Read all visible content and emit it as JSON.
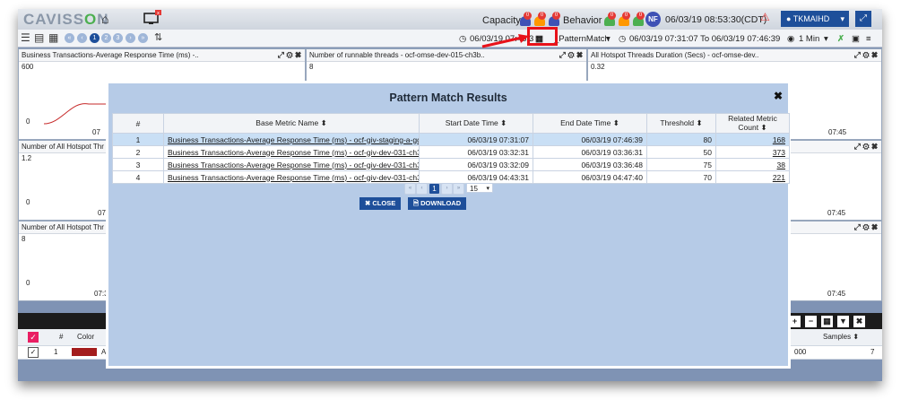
{
  "app": {
    "logo_text_before": "CAVISS",
    "logo_text_o": "O",
    "logo_text_after": "N",
    "capacity_label": "Capacity",
    "behavior_label": "Behavior",
    "alert_counts": [
      "0",
      "0",
      "0",
      "0",
      "0",
      "0"
    ],
    "nf_badge": "NF",
    "datetime": "06/03/19 08:53:30(CDT)",
    "user": "TKMAIHD",
    "colors": {
      "brand_dark": "#1e4f9a",
      "alert": "#e53935",
      "frame_bg": "#7f93b4",
      "modal_bg": "#b6cbe7"
    }
  },
  "toolbar": {
    "pages": [
      "1",
      "2",
      "3"
    ],
    "time_from": "06/03/19 07:46:3",
    "pattern_label": "_PatternMatch",
    "time_range": "06/03/19 07:31:07 To 06/03/19 07:46:39",
    "view_interval": "1 Min"
  },
  "panels": [
    {
      "title": "Business Transactions-Average Response Time (ms) -..",
      "y_top": "600",
      "y_bottom": "0",
      "x_label": "07"
    },
    {
      "title": "Number of runnable threads - ocf-omse-dev-015-ch3b..",
      "y_top": "8",
      "y_bottom": "",
      "x_label": ""
    },
    {
      "title": "All Hotspot Threads Duration (Secs) - ocf-omse-dev..",
      "y_top": "0.32",
      "y_bottom": "",
      "x_label": "07:45"
    },
    {
      "title": "Number of All Hotspot Thr",
      "y_top": "1.2",
      "y_bottom": "0",
      "x_label": "07:"
    },
    {
      "title": "",
      "y_top": "",
      "y_bottom": "",
      "x_label": "07:45"
    },
    {
      "title": "Number of All Hotspot Thr",
      "y_top": "8",
      "y_bottom": "0",
      "x_label": "07:3"
    },
    {
      "title": "",
      "y_top": "",
      "y_bottom": "",
      "x_label": "07:45"
    }
  ],
  "bottom_table": {
    "headers": {
      "num": "#",
      "color": "Color",
      "samples": "Samples ⬍"
    },
    "row": {
      "num": "1",
      "name_fragment": "A",
      "value_fragment": "000",
      "samples": "7"
    },
    "color_swatch": "#a31c1c"
  },
  "modal": {
    "title": "Pattern Match Results",
    "close_glyph": "✖",
    "columns": [
      "#",
      "Base Metric Name ⬍",
      "Start Date Time ⬍",
      "End Date Time ⬍",
      "Threshold ⬍",
      "Related Metric Count ⬍"
    ],
    "rows": [
      {
        "num": "1",
        "name": "Business Transactions-Average Response Time (ms) - ocf-giv-staging-a-gdc",
        "start": "06/03/19 07:31:07",
        "end": "06/03/19 07:46:39",
        "threshold": "80",
        "count": "168"
      },
      {
        "num": "2",
        "name": "Business Transactions-Average Response Time (ms) - ocf-giv-dev-031-ch3b",
        "start": "06/03/19 03:32:31",
        "end": "06/03/19 03:36:31",
        "threshold": "50",
        "count": "373"
      },
      {
        "num": "3",
        "name": "Business Transactions-Average Response Time (ms) - ocf-giv-dev-031-ch3b",
        "start": "06/03/19 03:32:09",
        "end": "06/03/19 03:36:48",
        "threshold": "75",
        "count": "38"
      },
      {
        "num": "4",
        "name": "Business Transactions-Average Response Time (ms) - ocf-giv-dev-031-ch3b",
        "start": "06/03/19 04:43:31",
        "end": "06/03/19 04:47:40",
        "threshold": "70",
        "count": "221"
      }
    ],
    "pager": {
      "current": "1",
      "page_size": "15"
    },
    "close_button": "CLOSE",
    "download_button": "DOWNLOAD"
  }
}
